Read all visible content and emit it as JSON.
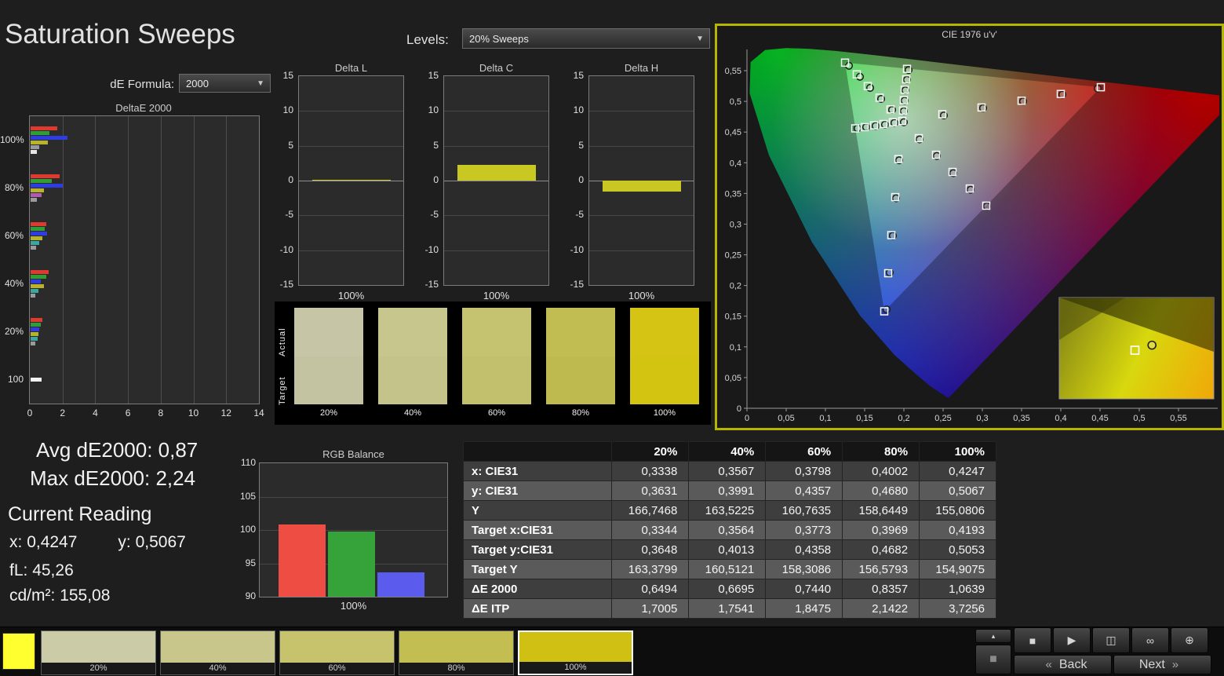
{
  "page": {
    "title": "Saturation Sweeps"
  },
  "controls": {
    "levels": {
      "label": "Levels:",
      "value": "20% Sweeps",
      "arrow_glyph": "▼"
    },
    "de_formula": {
      "label": "dE Formula:",
      "value": "2000",
      "arrow_glyph": "▼"
    }
  },
  "chart_data": [
    {
      "id": "deltae2000",
      "type": "bar",
      "orientation": "horizontal",
      "title": "DeltaE 2000",
      "xlim": [
        0,
        14
      ],
      "xticks": [
        0,
        2,
        4,
        6,
        8,
        10,
        12,
        14
      ],
      "groups": [
        {
          "label": "100%",
          "bars": [
            {
              "color": "#e03a30",
              "value": 1.62
            },
            {
              "color": "#2f9e35",
              "value": 1.15
            },
            {
              "color": "#2e3ce4",
              "value": 2.24
            },
            {
              "color": "#b8b32a",
              "value": 1.06
            },
            {
              "color": "#9a9a9a",
              "value": 0.55
            },
            {
              "color": "#e6e6e6",
              "value": 0.38
            }
          ]
        },
        {
          "label": "80%",
          "bars": [
            {
              "color": "#e03a30",
              "value": 1.75
            },
            {
              "color": "#2f9e35",
              "value": 1.3
            },
            {
              "color": "#2e3ce4",
              "value": 1.95
            },
            {
              "color": "#b8b32a",
              "value": 0.82
            },
            {
              "color": "#b05ab0",
              "value": 0.66
            },
            {
              "color": "#9a9a9a",
              "value": 0.4
            }
          ]
        },
        {
          "label": "60%",
          "bars": [
            {
              "color": "#e03a30",
              "value": 0.95
            },
            {
              "color": "#2f9e35",
              "value": 0.86
            },
            {
              "color": "#2e3ce4",
              "value": 1.02
            },
            {
              "color": "#b8b32a",
              "value": 0.74
            },
            {
              "color": "#3aa8a0",
              "value": 0.52
            },
            {
              "color": "#9a9a9a",
              "value": 0.33
            }
          ]
        },
        {
          "label": "40%",
          "bars": [
            {
              "color": "#e03a30",
              "value": 1.1
            },
            {
              "color": "#2f9e35",
              "value": 0.94
            },
            {
              "color": "#2e3ce4",
              "value": 0.62
            },
            {
              "color": "#b8b32a",
              "value": 0.8
            },
            {
              "color": "#3aa8a0",
              "value": 0.48
            },
            {
              "color": "#9a9a9a",
              "value": 0.3
            }
          ]
        },
        {
          "label": "20%",
          "bars": [
            {
              "color": "#e03a30",
              "value": 0.72
            },
            {
              "color": "#2f9e35",
              "value": 0.64
            },
            {
              "color": "#2e3ce4",
              "value": 0.55
            },
            {
              "color": "#b8b32a",
              "value": 0.49
            },
            {
              "color": "#3aa8a0",
              "value": 0.41
            },
            {
              "color": "#9a9a9a",
              "value": 0.28
            }
          ]
        },
        {
          "label": "100",
          "bars": [
            {
              "color": "#f2f2f2",
              "value": 0.66
            }
          ]
        }
      ]
    },
    {
      "id": "delta_l",
      "type": "bar",
      "title": "Delta L",
      "ylim": [
        -15,
        15
      ],
      "yticks": [
        15,
        10,
        5,
        0,
        -5,
        -10,
        -15
      ],
      "categories": [
        "100%"
      ],
      "values": [
        0.1
      ],
      "bar_color": "#c9c823",
      "xlabel": "100%"
    },
    {
      "id": "delta_c",
      "type": "bar",
      "title": "Delta C",
      "ylim": [
        -15,
        15
      ],
      "yticks": [
        15,
        10,
        5,
        0,
        -5,
        -10,
        -15
      ],
      "categories": [
        "100%"
      ],
      "values": [
        2.2
      ],
      "bar_color": "#c9c823",
      "xlabel": "100%"
    },
    {
      "id": "delta_h",
      "type": "bar",
      "title": "Delta H",
      "ylim": [
        -15,
        15
      ],
      "yticks": [
        15,
        10,
        5,
        0,
        -5,
        -10,
        -15
      ],
      "categories": [
        "100%"
      ],
      "values": [
        -1.6
      ],
      "bar_color": "#c9c823",
      "xlabel": "100%"
    },
    {
      "id": "rgb_balance",
      "type": "bar",
      "title": "RGB Balance",
      "ylim": [
        90,
        110
      ],
      "yticks": [
        110,
        105,
        100,
        95,
        90
      ],
      "xlabel": "100%",
      "series": [
        {
          "name": "Red",
          "color": "#ee4d44",
          "value": 100.8
        },
        {
          "name": "Green",
          "color": "#35a339",
          "value": 99.8
        },
        {
          "name": "Blue",
          "color": "#5b5bed",
          "value": 93.6
        }
      ]
    },
    {
      "id": "cie_1976",
      "type": "scatter",
      "title": "CIE 1976 u'v'",
      "xtick_values": [
        0,
        0.05,
        0.1,
        0.15,
        0.2,
        0.25,
        0.3,
        0.35,
        0.4,
        0.45,
        0.5,
        0.55
      ],
      "xtick_labels": [
        "0",
        "0,05",
        "0,1",
        "0,15",
        "0,2",
        "0,25",
        "0,3",
        "0,35",
        "0,4",
        "0,45",
        "0,5",
        "0,55"
      ],
      "ytick_values": [
        0,
        0.05,
        0.1,
        0.15,
        0.2,
        0.25,
        0.3,
        0.35,
        0.4,
        0.45,
        0.5,
        0.55
      ],
      "ytick_labels": [
        "0",
        "0,05",
        "0,1",
        "0,15",
        "0,2",
        "0,25",
        "0,3",
        "0,35",
        "0,4",
        "0,45",
        "0,5",
        "0,55"
      ],
      "gamut_triangle": [
        [
          0.451,
          0.523
        ],
        [
          0.125,
          0.563
        ],
        [
          0.175,
          0.158
        ]
      ],
      "targets": [
        [
          0.198,
          0.468
        ],
        [
          0.249,
          0.479
        ],
        [
          0.299,
          0.49
        ],
        [
          0.35,
          0.501
        ],
        [
          0.4,
          0.512
        ],
        [
          0.451,
          0.523
        ],
        [
          0.183,
          0.487
        ],
        [
          0.169,
          0.506
        ],
        [
          0.154,
          0.525
        ],
        [
          0.14,
          0.544
        ],
        [
          0.125,
          0.563
        ],
        [
          0.193,
          0.406
        ],
        [
          0.189,
          0.344
        ],
        [
          0.184,
          0.282
        ],
        [
          0.18,
          0.22
        ],
        [
          0.175,
          0.158
        ],
        [
          0.186,
          0.466
        ],
        [
          0.174,
          0.463
        ],
        [
          0.162,
          0.461
        ],
        [
          0.15,
          0.458
        ],
        [
          0.138,
          0.456
        ],
        [
          0.219,
          0.44
        ],
        [
          0.241,
          0.413
        ],
        [
          0.262,
          0.385
        ],
        [
          0.284,
          0.358
        ],
        [
          0.305,
          0.33
        ],
        [
          0.199,
          0.485
        ],
        [
          0.2,
          0.502
        ],
        [
          0.201,
          0.519
        ],
        [
          0.203,
          0.536
        ],
        [
          0.204,
          0.553
        ]
      ],
      "measurements": [
        [
          0.2,
          0.466
        ],
        [
          0.251,
          0.477
        ],
        [
          0.301,
          0.489
        ],
        [
          0.352,
          0.5
        ],
        [
          0.402,
          0.511
        ],
        [
          0.447,
          0.521
        ],
        [
          0.185,
          0.486
        ],
        [
          0.171,
          0.504
        ],
        [
          0.157,
          0.522
        ],
        [
          0.144,
          0.54
        ],
        [
          0.13,
          0.558
        ],
        [
          0.194,
          0.404
        ],
        [
          0.19,
          0.342
        ],
        [
          0.186,
          0.281
        ],
        [
          0.182,
          0.221
        ],
        [
          0.178,
          0.161
        ],
        [
          0.188,
          0.465
        ],
        [
          0.176,
          0.462
        ],
        [
          0.164,
          0.46
        ],
        [
          0.152,
          0.458
        ],
        [
          0.141,
          0.456
        ],
        [
          0.22,
          0.438
        ],
        [
          0.242,
          0.411
        ],
        [
          0.263,
          0.383
        ],
        [
          0.285,
          0.356
        ],
        [
          0.306,
          0.329
        ],
        [
          0.2,
          0.484
        ],
        [
          0.201,
          0.501
        ],
        [
          0.202,
          0.518
        ],
        [
          0.204,
          0.535
        ],
        [
          0.206,
          0.551
        ]
      ],
      "inset": {
        "square": [
          0.49,
          0.52
        ],
        "circle": [
          0.6,
          0.47
        ],
        "colors": [
          "#8a8a16",
          "#d8d80e",
          "#f0a808"
        ]
      }
    }
  ],
  "swatch_panel": {
    "row_labels": [
      "Actual",
      "Target"
    ],
    "swatches": [
      {
        "label": "20%",
        "actual": "#c6c6a6",
        "target": "#c3c3a2"
      },
      {
        "label": "40%",
        "actual": "#c7c68c",
        "target": "#c4c389"
      },
      {
        "label": "60%",
        "actual": "#c6c370",
        "target": "#c3c06d"
      },
      {
        "label": "80%",
        "actual": "#c2bd52",
        "target": "#bfba4f"
      },
      {
        "label": "100%",
        "actual": "#d6c415",
        "target": "#d2c410"
      }
    ]
  },
  "stats": {
    "avg_label": "Avg dE2000:",
    "avg_value": "0,87",
    "max_label": "Max dE2000:",
    "max_value": "2,24",
    "current_reading_label": "Current Reading",
    "x_label": "x:",
    "x_value": "0,4247",
    "y_label": "y:",
    "y_value": "0,5067",
    "fl_label": "fL:",
    "fl_value": "45,26",
    "cd_label": "cd/m²:",
    "cd_value": "155,08"
  },
  "table": {
    "columns": [
      "20%",
      "40%",
      "60%",
      "80%",
      "100%"
    ],
    "rows": [
      {
        "label": "x: CIE31",
        "values": [
          "0,3338",
          "0,3567",
          "0,3798",
          "0,4002",
          "0,4247"
        ]
      },
      {
        "label": "y: CIE31",
        "values": [
          "0,3631",
          "0,3991",
          "0,4357",
          "0,4680",
          "0,5067"
        ]
      },
      {
        "label": "Y",
        "values": [
          "166,7468",
          "163,5225",
          "160,7635",
          "158,6449",
          "155,0806"
        ]
      },
      {
        "label": "Target x:CIE31",
        "values": [
          "0,3344",
          "0,3564",
          "0,3773",
          "0,3969",
          "0,4193"
        ]
      },
      {
        "label": "Target y:CIE31",
        "values": [
          "0,3648",
          "0,4013",
          "0,4358",
          "0,4682",
          "0,5053"
        ]
      },
      {
        "label": "Target Y",
        "values": [
          "163,3799",
          "160,5121",
          "158,3086",
          "156,5793",
          "154,9075"
        ]
      },
      {
        "label": "ΔE 2000",
        "values": [
          "0,6494",
          "0,6695",
          "0,7440",
          "0,8357",
          "1,0639"
        ]
      },
      {
        "label": "ΔE ITP",
        "values": [
          "1,7005",
          "1,7541",
          "1,8475",
          "2,1422",
          "3,7256"
        ]
      }
    ]
  },
  "bottom_bar": {
    "current_color": "#ffff30",
    "tiles": [
      {
        "label": "20%",
        "color": "#cbcba8",
        "selected": false
      },
      {
        "label": "40%",
        "color": "#c9c68c",
        "selected": false
      },
      {
        "label": "60%",
        "color": "#c7c36d",
        "selected": false
      },
      {
        "label": "80%",
        "color": "#c3be52",
        "selected": false
      },
      {
        "label": "100%",
        "color": "#cfc013",
        "selected": true
      }
    ],
    "icon_buttons": [
      {
        "name": "stop-icon",
        "glyph": "■"
      },
      {
        "name": "play-icon",
        "glyph": "▶"
      },
      {
        "name": "frame-icon",
        "glyph": "◫"
      },
      {
        "name": "loop-icon",
        "glyph": "∞"
      },
      {
        "name": "target-icon",
        "glyph": "⊕"
      }
    ],
    "panel_toggle_glyph": "▴",
    "display_button_glyph": "■",
    "back_label": "Back",
    "next_label": "Next",
    "back_chevron": "«",
    "next_chevron": "»"
  }
}
